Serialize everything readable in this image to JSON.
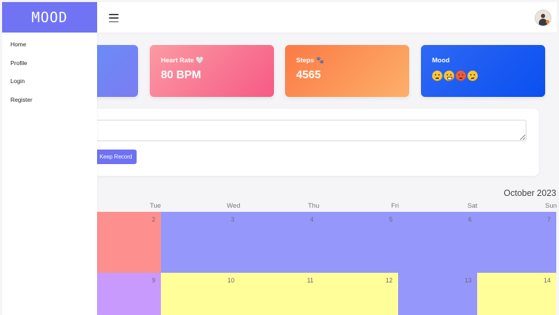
{
  "brand": {
    "title": "MOOD"
  },
  "sidebar": {
    "items": [
      {
        "label": "Home"
      },
      {
        "label": "Profile"
      },
      {
        "label": "Login"
      },
      {
        "label": "Register"
      }
    ]
  },
  "cards": {
    "heart": {
      "label": "Heart Rate 🤍",
      "value": "80 BPM"
    },
    "steps": {
      "label": "Steps 🐾",
      "value": "4565"
    },
    "mood": {
      "label": "Mood",
      "emojis": [
        "slight-smile",
        "grin",
        "angry",
        "raised-eyebrow"
      ]
    }
  },
  "record": {
    "button": "Keep Record",
    "value": ""
  },
  "calendar": {
    "month": "October 2023",
    "days": [
      "Tue",
      "Wed",
      "Thu",
      "Fri",
      "Sat",
      "Sun"
    ],
    "week1": [
      "2",
      "3",
      "4",
      "5",
      "6",
      "7"
    ],
    "week2": [
      "9",
      "10",
      "11",
      "12",
      "13",
      "14"
    ]
  },
  "colors": {
    "accent": "#7173f5",
    "cal_periwinkle": "#9697fb",
    "cal_red": "#fd8f8f",
    "cal_yellow": "#fffe99",
    "cal_lavender": "#c99afd"
  }
}
